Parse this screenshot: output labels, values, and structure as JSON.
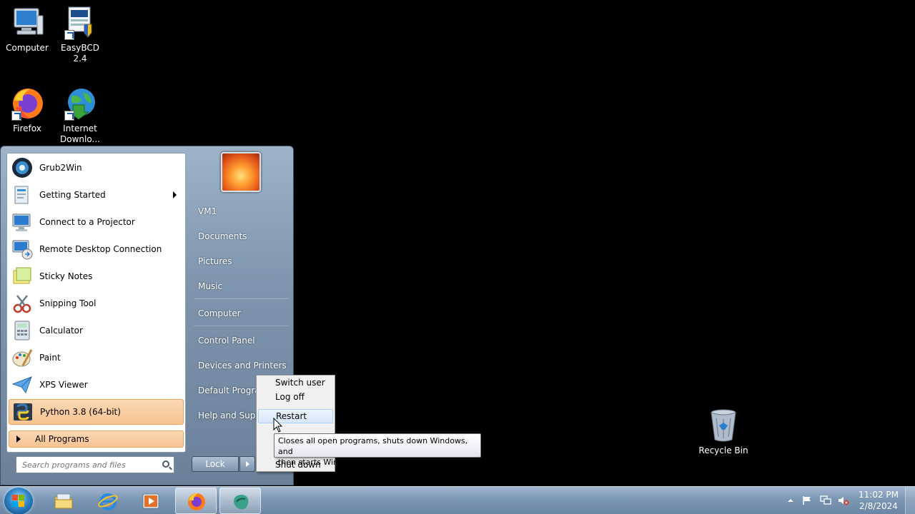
{
  "desktop": {
    "icons": [
      {
        "label": "Computer",
        "icon": "computer-icon"
      },
      {
        "label": "EasyBCD 2.4",
        "icon": "easybcd-icon"
      },
      {
        "label": "Firefox",
        "icon": "firefox-icon"
      },
      {
        "label": "Internet Downlo...",
        "icon": "idm-icon"
      },
      {
        "label": "Recycle Bin",
        "icon": "recycle-bin-icon"
      }
    ]
  },
  "start_menu": {
    "programs": [
      {
        "label": "Grub2Win",
        "icon": "grub2win-icon"
      },
      {
        "label": "Getting Started",
        "icon": "getting-started-icon",
        "submenu": true
      },
      {
        "label": "Connect to a Projector",
        "icon": "projector-icon"
      },
      {
        "label": "Remote Desktop Connection",
        "icon": "remote-desktop-icon"
      },
      {
        "label": "Sticky Notes",
        "icon": "sticky-notes-icon"
      },
      {
        "label": "Snipping Tool",
        "icon": "snipping-tool-icon"
      },
      {
        "label": "Calculator",
        "icon": "calculator-icon"
      },
      {
        "label": "Paint",
        "icon": "paint-icon"
      },
      {
        "label": "XPS Viewer",
        "icon": "xps-viewer-icon"
      },
      {
        "label": "Python 3.8 (64-bit)",
        "icon": "python-icon",
        "highlighted": true
      }
    ],
    "all_programs": "All Programs",
    "search_placeholder": "Search programs and files",
    "right_items": [
      "VM1",
      "Documents",
      "Pictures",
      "Music",
      "Computer",
      "Control Panel",
      "Devices and Printers",
      "Default Programs",
      "Help and Support"
    ],
    "lock_label": "Lock"
  },
  "power_menu": {
    "items": [
      "Switch user",
      "Log off",
      "Restart",
      "Shut down"
    ],
    "hovered": "Restart"
  },
  "tooltip": {
    "line1": "Closes all open programs, shuts down Windows, and",
    "line2": "then starts Windows again."
  },
  "taskbar": {
    "apps": [
      "explorer-icon",
      "internet-explorer-icon",
      "media-player-icon",
      "firefox-icon",
      "grub2win-icon"
    ],
    "clock_time": "11:02 PM",
    "clock_date": "2/8/2024"
  }
}
